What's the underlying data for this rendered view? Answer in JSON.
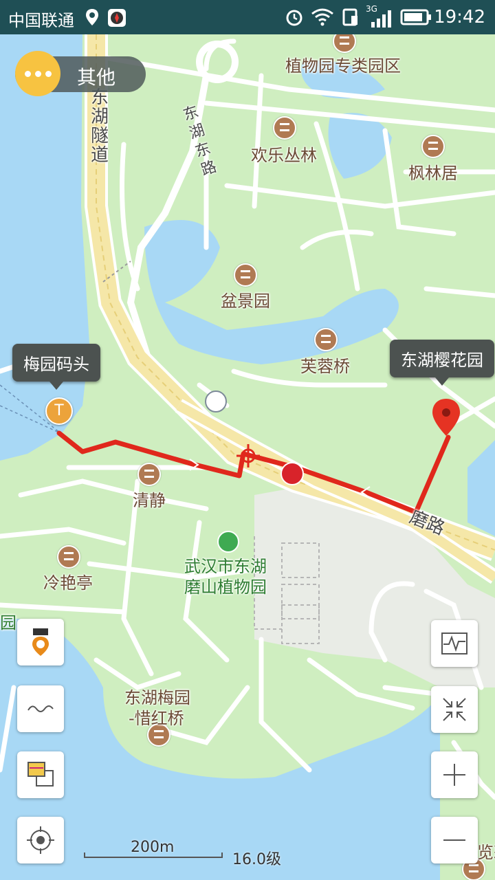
{
  "status_bar": {
    "carrier": "中国联通",
    "time": "19:42",
    "network": "3G"
  },
  "top_left": {
    "other_label": "其他"
  },
  "map": {
    "places": {
      "botanical_zone": "植物园专类园区",
      "joy_forest": "欢乐丛林",
      "maple_forest": "枫林居",
      "bonsai_garden": "盆景园",
      "hibiscus_bridge": "芙蓉桥",
      "qingjing": "清静",
      "lengyan_pavilion": "冷艳亭",
      "botanical_garden_l1": "武汉市东湖",
      "botanical_garden_l2": "磨山植物园",
      "meiyuan_l1": "东湖梅园",
      "meiyuan_l2": "-惜红桥",
      "edge_left": "园",
      "edge_right": "览彩"
    },
    "roads": {
      "tunnel": [
        "东",
        "湖",
        "隧",
        "道"
      ],
      "donghu_east": [
        "东",
        "湖",
        "东",
        "路"
      ],
      "moshan_road": "磨路"
    },
    "callouts": {
      "start": "梅园码头",
      "end": "东湖樱花园"
    },
    "start_marker_letter": "T"
  },
  "controls": {
    "left": [
      "poi-layer-icon",
      "track-icon",
      "map-layer-icon",
      "locate-icon"
    ],
    "right": [
      "chart-icon",
      "collapse-icon",
      "zoom-in-icon",
      "zoom-out-icon"
    ]
  },
  "scale": {
    "distance": "200m",
    "zoom_level": "16.0级"
  },
  "colors": {
    "route": "#e0281c",
    "water": "#a8d8f5",
    "land": "#cfeec0",
    "status_bar": "#1f4f55",
    "callout_bg": "#4c5250",
    "accent_yellow": "#f7c341"
  }
}
